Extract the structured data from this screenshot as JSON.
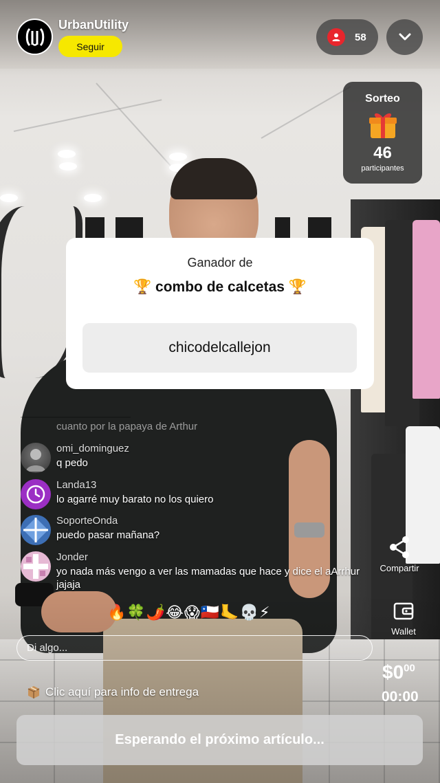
{
  "header": {
    "channel_name": "UrbanUtility",
    "follow_label": "Seguir",
    "viewer_count": "58"
  },
  "giveaway": {
    "title": "Sorteo",
    "participants_count": "46",
    "participants_label": "participantes"
  },
  "winner": {
    "heading": "Ganador de",
    "prize": "🏆 combo de calcetas 🏆",
    "username": "chicodelcallejon"
  },
  "chat": {
    "partial_message": "cuanto por la papaya de Arthur",
    "messages": [
      {
        "user": "omi_dominguez",
        "text": "q pedo"
      },
      {
        "user": "Landa13",
        "text": "lo agarré muy barato no los quiero"
      },
      {
        "user": "SoporteOnda",
        "text": "puedo pasar mañana?"
      },
      {
        "user": "Jonder",
        "text": "yo nada más vengo a ver las mamadas que hace y dice el aArrhur jajaja"
      }
    ]
  },
  "reactions": "🔥🍀🌶️😂😱🇨🇱🦶💀⚡",
  "input": {
    "placeholder": "Di algo..."
  },
  "delivery_info": "Clic aquí para info de entrega",
  "right_rail": {
    "share_label": "Compartir",
    "wallet_label": "Wallet",
    "price_main": "$0",
    "price_cents": "00",
    "timer": "00:00"
  },
  "bottom_button_label": "Esperando el próximo artículo...",
  "colors": {
    "follow_yellow": "#f6e800",
    "viewer_red": "#e8262c"
  }
}
